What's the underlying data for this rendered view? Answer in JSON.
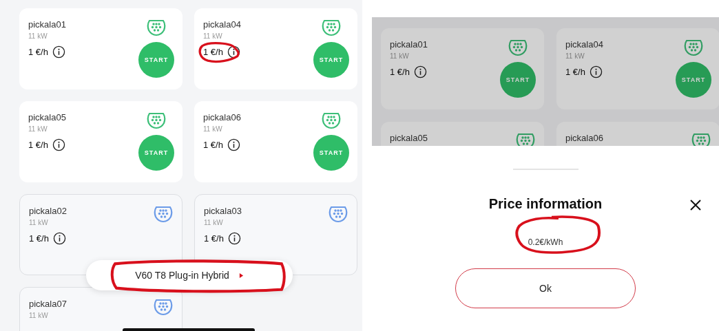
{
  "left_screen": {
    "chargers": [
      {
        "name": "pickala01",
        "power": "11 kW",
        "price": "1 €/h",
        "kind": "available",
        "action": "START",
        "annotated": false
      },
      {
        "name": "pickala04",
        "power": "11 kW",
        "price": "1 €/h",
        "kind": "available",
        "action": "START",
        "annotated": true
      },
      {
        "name": "pickala05",
        "power": "11 kW",
        "price": "1 €/h",
        "kind": "available",
        "action": "START",
        "annotated": false
      },
      {
        "name": "pickala06",
        "power": "11 kW",
        "price": "1 €/h",
        "kind": "available",
        "action": "START",
        "annotated": false
      },
      {
        "name": "pickala02",
        "power": "11 kW",
        "price": "1 €/h",
        "kind": "occupied",
        "annotated": false
      },
      {
        "name": "pickala03",
        "power": "11 kW",
        "price": "1 €/h",
        "kind": "occupied",
        "annotated": false
      },
      {
        "name": "pickala07",
        "power": "11 kW",
        "kind": "occupied"
      }
    ],
    "vehicle_chip": {
      "label": "V60 T8 Plug-in Hybrid",
      "annotated": true
    }
  },
  "right_screen": {
    "chargers": [
      {
        "name": "pickala01",
        "power": "11 kW",
        "price": "1 €/h",
        "kind": "available",
        "action": "START"
      },
      {
        "name": "pickala04",
        "power": "11 kW",
        "price": "1 €/h",
        "kind": "available",
        "action": "START"
      },
      {
        "name": "pickala05",
        "kind": "available"
      },
      {
        "name": "pickala06",
        "kind": "available"
      }
    ],
    "price_sheet": {
      "title": "Price information",
      "price": "0.2€/kWh",
      "price_annotated": true,
      "button": "Ok"
    }
  }
}
